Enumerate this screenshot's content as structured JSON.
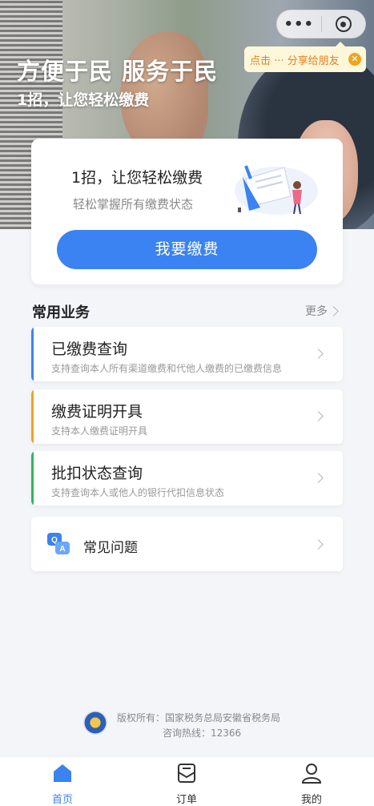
{
  "hero": {
    "title": "方便于民 服务于民",
    "subtitle": "1招，让您轻松缴费"
  },
  "capsule": {
    "more_icon": "more-dots-icon",
    "close_icon": "close-circle-icon"
  },
  "share_tip": {
    "text": "点击 ··· 分享给朋友",
    "close_icon": "close-icon"
  },
  "card": {
    "title": "1招，让您轻松缴费",
    "subtitle": "轻松掌握所有缴费状态",
    "button": "我要缴费"
  },
  "section": {
    "title": "常用业务",
    "more": "更多"
  },
  "services": [
    {
      "title": "已缴费查询",
      "desc": "支持查询本人所有渠道缴费和代他人缴费的已缴费信息",
      "color": "#3b82f2"
    },
    {
      "title": "缴费证明开具",
      "desc": "支持本人缴费证明开具",
      "color": "#f0a31f"
    },
    {
      "title": "批扣状态查询",
      "desc": "支持查询本人或他人的银行代扣信息状态",
      "color": "#2fb65a"
    }
  ],
  "faq": {
    "title": "常见问题",
    "icon": "qa-icon"
  },
  "footer": {
    "line1": "版权所有：国家税务总局安徽省税务局",
    "line2": "咨询热线：12366"
  },
  "tabs": [
    {
      "label": "首页",
      "icon": "home-icon",
      "active": true
    },
    {
      "label": "订单",
      "icon": "order-icon",
      "active": false
    },
    {
      "label": "我的",
      "icon": "user-icon",
      "active": false
    }
  ],
  "colors": {
    "accent": "#3b82f2",
    "background": "#f3f5f9"
  }
}
